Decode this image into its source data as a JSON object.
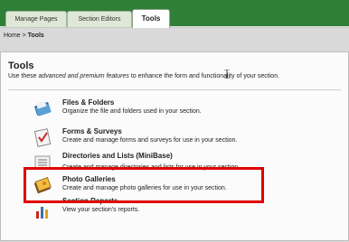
{
  "tabs": [
    {
      "label": "Manage Pages",
      "active": false
    },
    {
      "label": "Section Editors",
      "active": false
    },
    {
      "label": "Tools",
      "active": true
    }
  ],
  "breadcrumb": {
    "home": "Home",
    "sep": " > ",
    "current": "Tools"
  },
  "tools": {
    "title": "Tools",
    "desc_pre": "Use these ",
    "desc_em": "advanced and premium features",
    "desc_post": " to enhance the form and functionality of your section."
  },
  "items": [
    {
      "title": "Files & Folders",
      "desc": "Organize the file and folders used in your section.",
      "icon": "files-folders-icon"
    },
    {
      "title": "Forms & Surveys",
      "desc": "Create and manage forms and surveys for use in your section.",
      "icon": "forms-surveys-icon"
    },
    {
      "title": "Directories and Lists (MiniBase)",
      "desc": "Create and manage directories and lists for use in your section.",
      "icon": "directories-lists-icon"
    },
    {
      "title": "Photo Galleries",
      "desc": "Create and manage photo galleries for use in your section.",
      "icon": "photo-galleries-icon"
    },
    {
      "title": "Section Reports",
      "desc": "View your section's reports.",
      "icon": "section-reports-icon"
    }
  ],
  "highlight_color": "#e00000",
  "accent_green": "#2f7f38"
}
